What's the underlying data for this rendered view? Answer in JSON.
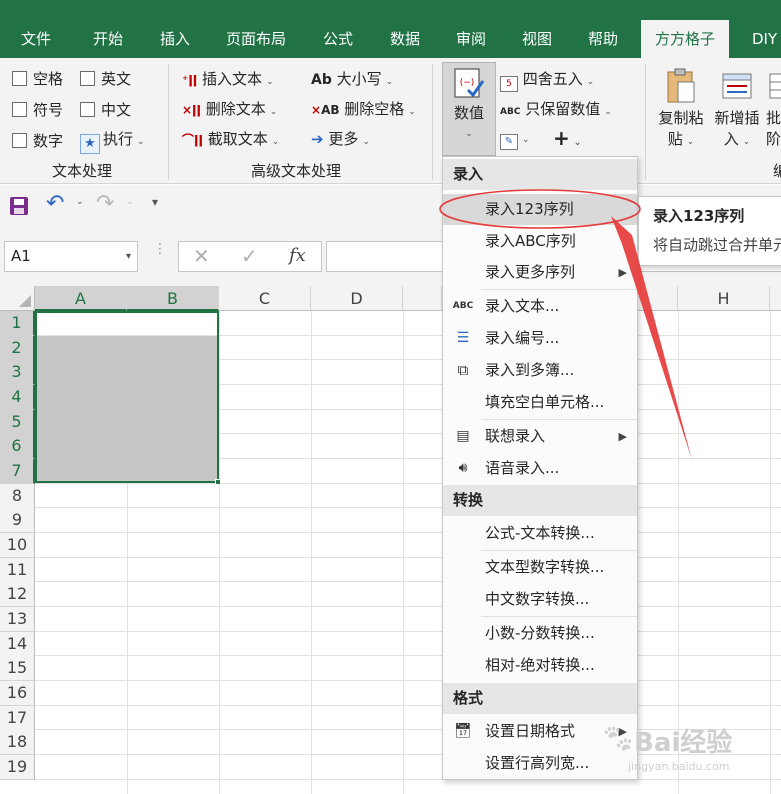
{
  "ribbon_tabs": [
    "文件",
    "开始",
    "插入",
    "页面布局",
    "公式",
    "数据",
    "审阅",
    "视图",
    "帮助",
    "方方格子",
    "DIY"
  ],
  "text_group": {
    "checkboxes": [
      "空格",
      "英文",
      "符号",
      "中文",
      "数字"
    ],
    "execute_label": "执行",
    "group_label": "文本处理"
  },
  "adv_text_group": {
    "insert_label": "插入文本",
    "delete_label": "删除文本",
    "cut_label": "截取文本",
    "case_label": "大小写",
    "case_icon_text": "Ab",
    "del_space_label": "删除空格",
    "del_space_icon_text": "AB",
    "more_label": "更多",
    "group_label": "高级文本处理"
  },
  "value_group": {
    "value_button_label": "数值",
    "round_label": "四舍五入",
    "keep_values_label": "只保留数值",
    "keep_values_icon_text": "ABC"
  },
  "copy_group": {
    "copy_paste_label_1": "复制粘",
    "copy_paste_label_2": "贴",
    "add_insert_label_1": "新增插",
    "add_insert_label_2": "入",
    "batch_label_1": "批",
    "batch_label_2": "阶",
    "group_label_partial": "编"
  },
  "formula_bar": {
    "name_box": "A1",
    "fx_label": "fx"
  },
  "grid": {
    "columns": [
      "A",
      "B",
      "C",
      "D",
      "H"
    ],
    "rows": [
      "1",
      "2",
      "3",
      "4",
      "5",
      "6",
      "7",
      "8",
      "9",
      "10",
      "11",
      "12",
      "13",
      "14",
      "15",
      "16",
      "17",
      "18",
      "19"
    ]
  },
  "menu": {
    "sections": [
      "录入",
      "转换",
      "格式"
    ],
    "items": [
      "录入123序列",
      "录入ABC序列",
      "录入更多序列",
      "录入文本...",
      "录入编号...",
      "录入到多簿...",
      "填充空白单元格...",
      "联想录入",
      "语音录入...",
      "公式-文本转换...",
      "文本型数字转换...",
      "中文数字转换...",
      "小数-分数转换...",
      "相对-绝对转换...",
      "设置日期格式",
      "设置行高列宽..."
    ],
    "text_icon": "ABC"
  },
  "tooltip": {
    "title": "录入123序列",
    "desc": "将自动跳过合并单元"
  },
  "watermark": {
    "text": "Bai经验",
    "url": "jingyan.baidu.com"
  },
  "colors": {
    "excel_green": "#217346",
    "ribbon_bg": "#f3f3f3",
    "selection_gray": "#c6c6c6",
    "annotation_red": "#e63b3b"
  }
}
